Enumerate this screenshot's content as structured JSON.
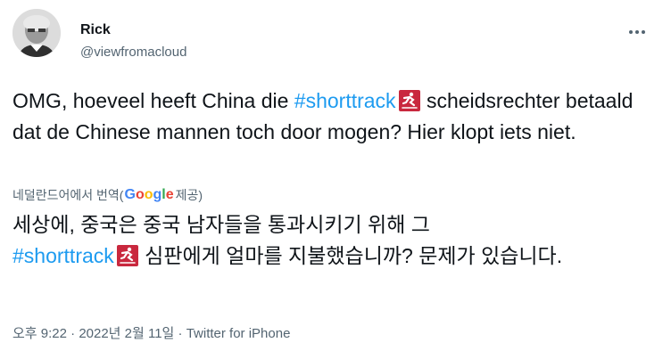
{
  "author": {
    "display_name": "Rick",
    "handle": "@viewfromacloud"
  },
  "tweet": {
    "text_before": "OMG, hoeveel heeft China die ",
    "hashtag": "#shorttrack",
    "text_after": " scheidsrechter betaald dat de Chinese mannen toch door mogen? Hier klopt iets niet.",
    "emoji_icon": "short-track-skating-icon"
  },
  "translation": {
    "label": "네덜란드어에서 번역(",
    "provider_logo": "Google",
    "label_suffix": " 제공)",
    "text_before": "세상에, 중국은 중국 남자들을 통과시키기 위해 그 ",
    "hashtag": "#shorttrack",
    "text_after": " 심판에게 얼마를 지불했습니까? 문제가 있습니다."
  },
  "meta": {
    "time": "오후 9:22",
    "separator": " · ",
    "date": "2022년 2월 11일",
    "source": "Twitter for iPhone"
  },
  "colors": {
    "accent": "#1d9bf0",
    "secondary_text": "#536471",
    "emoji_background": "#c9283e"
  }
}
